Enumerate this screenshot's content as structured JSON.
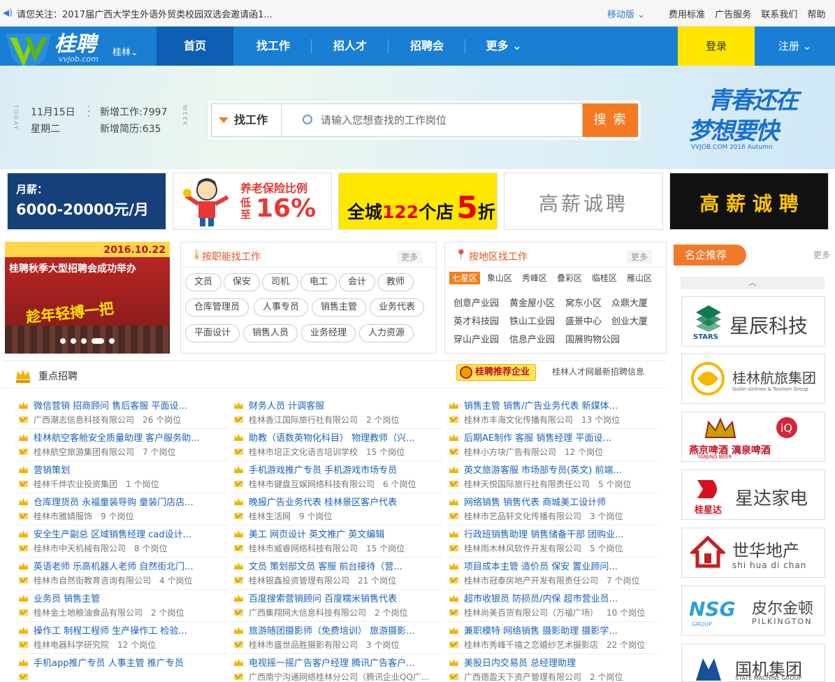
{
  "topbar": {
    "notice": "请您关注：2017届广西大学生外语外贸类校园双选会邀请函1...",
    "mobile": "移动版",
    "links": [
      "费用标准",
      "广告服务",
      "联系我们",
      "帮助"
    ]
  },
  "header": {
    "brand": "桂聘",
    "domain": "vvjob.com",
    "city": "桂林",
    "nav": [
      "首页",
      "找工作",
      "招人才",
      "招聘会",
      "更多"
    ],
    "login": "登录",
    "register": "注册"
  },
  "banner": {
    "date": "11月15日",
    "weekday": "星期二",
    "new_jobs": "新增工作:7997",
    "new_resumes": "新增简历:635",
    "deco_left": "TODAY",
    "deco_right": "WEEK",
    "search_type": "找工作",
    "search_placeholder": "请输入您想查找的工作岗位",
    "search_button": "搜 索",
    "slogan_line1": "青春还在",
    "slogan_line2": "梦想要快",
    "slogan_sub": "VVJOB.COM 2016  Autumn"
  },
  "ads": {
    "ad1_label": "月薪：",
    "ad1_value": "6000-20000元/月",
    "ad2_title": "养老保险比例",
    "ad2_low": "低至",
    "ad2_pct": "16%",
    "ad3_text1": "全城",
    "ad3_num": "122",
    "ad3_text2": "个店",
    "ad3_discount": "5",
    "ad3_zhe": "折",
    "ad4_text": "高薪诚聘",
    "ad5_text": "高 薪 诚 聘"
  },
  "slideshow": {
    "date": "2016.10.22",
    "caption": "桂聘秋季大型招聘会成功举办",
    "banner_text": "趁年轻搏一把"
  },
  "function_panel": {
    "title": "按职能找工作",
    "more": "更多",
    "tags": [
      "文员",
      "保安",
      "司机",
      "电工",
      "会计",
      "教师",
      "仓库管理员",
      "人事专员",
      "销售主管",
      "业务代表",
      "平面设计",
      "销售人员",
      "业务经理",
      "人力资源"
    ]
  },
  "area_panel": {
    "title": "按地区找工作",
    "more": "更多",
    "districts": [
      "七星区",
      "象山区",
      "秀峰区",
      "叠彩区",
      "临桂区",
      "雁山区"
    ],
    "places": [
      "创意产业园",
      "黄金屋小区",
      "窝东小区",
      "众鼎大厦",
      "英才科技园",
      "铁山工业园",
      "盛景中心",
      "创业大厦",
      "穿山产业园",
      "信息产业园",
      "国展购物公园"
    ]
  },
  "famous": {
    "title": "名企推荐",
    "more": "更多",
    "companies": [
      {
        "name": "星辰科技",
        "sub": "STARS"
      },
      {
        "name": "桂林航旅集团",
        "sub": "Guilin Airlines & Tourism Group"
      },
      {
        "name": "燕京啤酒  漓泉啤酒",
        "sub": "YANJING BEER"
      },
      {
        "name": "星达家电",
        "sub": "桂星达"
      },
      {
        "name": "世华地产",
        "sub": "shi hua di chan"
      },
      {
        "name": "皮尔金顿",
        "sub": "PILKINGTON"
      },
      {
        "name": "国机集团",
        "sub": "STATE MACHINE GROUP"
      }
    ]
  },
  "key": {
    "title": "重点招聘",
    "badge": "桂聘推荐企业",
    "latest": "桂林人才网最新招聘信息",
    "col1": [
      {
        "jobs": "微信营销   招商顾问   售后客服   平面设...",
        "company": "广西潮志信息科技有限公司",
        "count": "26 个岗位"
      },
      {
        "jobs": "桂林航空客舱安全质量助理   客户服务助...",
        "company": "桂林航空旅游集团有限公司",
        "count": "7 个岗位"
      },
      {
        "jobs": "营销策划",
        "company": "桂林千烨农业投资集团",
        "count": "1 个岗位"
      },
      {
        "jobs": "仓库理货员   永福童装导购   童装门店店...",
        "company": "桂林市雅婧服饰",
        "count": "9 个岗位"
      },
      {
        "jobs": "安全生产副总   区域销售经理   cad设计...",
        "company": "桂林市中天机械有限公司",
        "count": "8 个岗位"
      },
      {
        "jobs": "英语老师   乐高机器人老师   自然街北门...",
        "company": "桂林市自然街教育咨询有限公司",
        "count": "4 个岗位"
      },
      {
        "jobs": "业务员   销售主管",
        "company": "桂林金土地粮油食品有限公司",
        "count": "2 个岗位"
      },
      {
        "jobs": "操作工   制程工程师   生产操作工   检验...",
        "company": "桂林电器科学研究院",
        "count": "12 个岗位"
      },
      {
        "jobs": "手机app推广专员   人事主管   推广专员",
        "company": "",
        "count": ""
      }
    ],
    "col2": [
      {
        "jobs": "财务人员   计调客服",
        "company": "桂林香江国际旅行社有限公司",
        "count": "2 个岗位"
      },
      {
        "jobs": "助教（语数英物化科目）   物理教师（兴...",
        "company": "桂林市培正文化语言培训学校",
        "count": "15 个岗位"
      },
      {
        "jobs": "手机游戏推广专员   手机游戏市场专员",
        "company": "桂林市键盘互娱网络科技有限公司",
        "count": "6 个岗位"
      },
      {
        "jobs": "晚报广告业务代表   桂林景区客户代表",
        "company": "桂林生活网",
        "count": "9 个岗位"
      },
      {
        "jobs": "美工   网页设计   英文推广   英文编辑",
        "company": "桂林市威睿网络科技有限公司",
        "count": "15 个岗位"
      },
      {
        "jobs": "文员   策划部文员   客服   前台接待（营...",
        "company": "桂林银鑫投资管理有限公司",
        "count": "21 个岗位"
      },
      {
        "jobs": "百度搜索营销顾问   百度糯米销售代表",
        "company": "广西集翔网大信息科技有限公司",
        "count": "2 个岗位"
      },
      {
        "jobs": "旅游随团摄影师（免费培训）   旅游摄影...",
        "company": "桂林市盛世品胜摄影有限公司",
        "count": "3 个岗位"
      },
      {
        "jobs": "电视摇一摇广告客户经理   腾讯广告客户...",
        "company": "广西南宁沟通网络桂林分公司（腾讯企业QQ广...",
        "count": ""
      }
    ],
    "col3": [
      {
        "jobs": "销售主管   销售/广告业务代表   新媒体...",
        "company": "桂林市丰海文化传播有限公司",
        "count": "13 个岗位"
      },
      {
        "jobs": "后期AE制作   客服   销售经理   平面设...",
        "company": "桂林小方块广告有限公司",
        "count": "12 个岗位"
      },
      {
        "jobs": "英文旅游客服   市场部专员(英文)   前端...",
        "company": "桂林天悦国际旅行社有限责任公司",
        "count": "5 个岗位"
      },
      {
        "jobs": "网络销售   销售代表   商城美工设计师",
        "company": "桂林市艺品轩文化传播有限公司",
        "count": "3 个岗位"
      },
      {
        "jobs": "行政班销售助理   销售储备干部   团购业...",
        "company": "桂林雨木林风软件开发有限公司",
        "count": "5 个岗位"
      },
      {
        "jobs": "项目成本主管   造价员   保安   置业顾问...",
        "company": "桂林市冠泰房地产开发有限责任公司",
        "count": "7 个岗位"
      },
      {
        "jobs": "超市收银员   防损员/内保   超市营业员...",
        "company": "桂林尚美百货有限公司（万福广场）",
        "count": "10 个岗位"
      },
      {
        "jobs": "兼职模特   网络销售   摄影助理   摄影学...",
        "company": "桂林市秀峰千禧之恋婚纱艺术摄影店",
        "count": "22 个岗位"
      },
      {
        "jobs": "美股日内交易员   总经理助理",
        "company": "广西德盈天下资产管理有限公司",
        "count": "2 个岗位"
      }
    ]
  },
  "colors": {
    "nav": "#1a7fd4",
    "accent": "#f47920",
    "login": "#ffe500",
    "link": "#1a62b4"
  }
}
